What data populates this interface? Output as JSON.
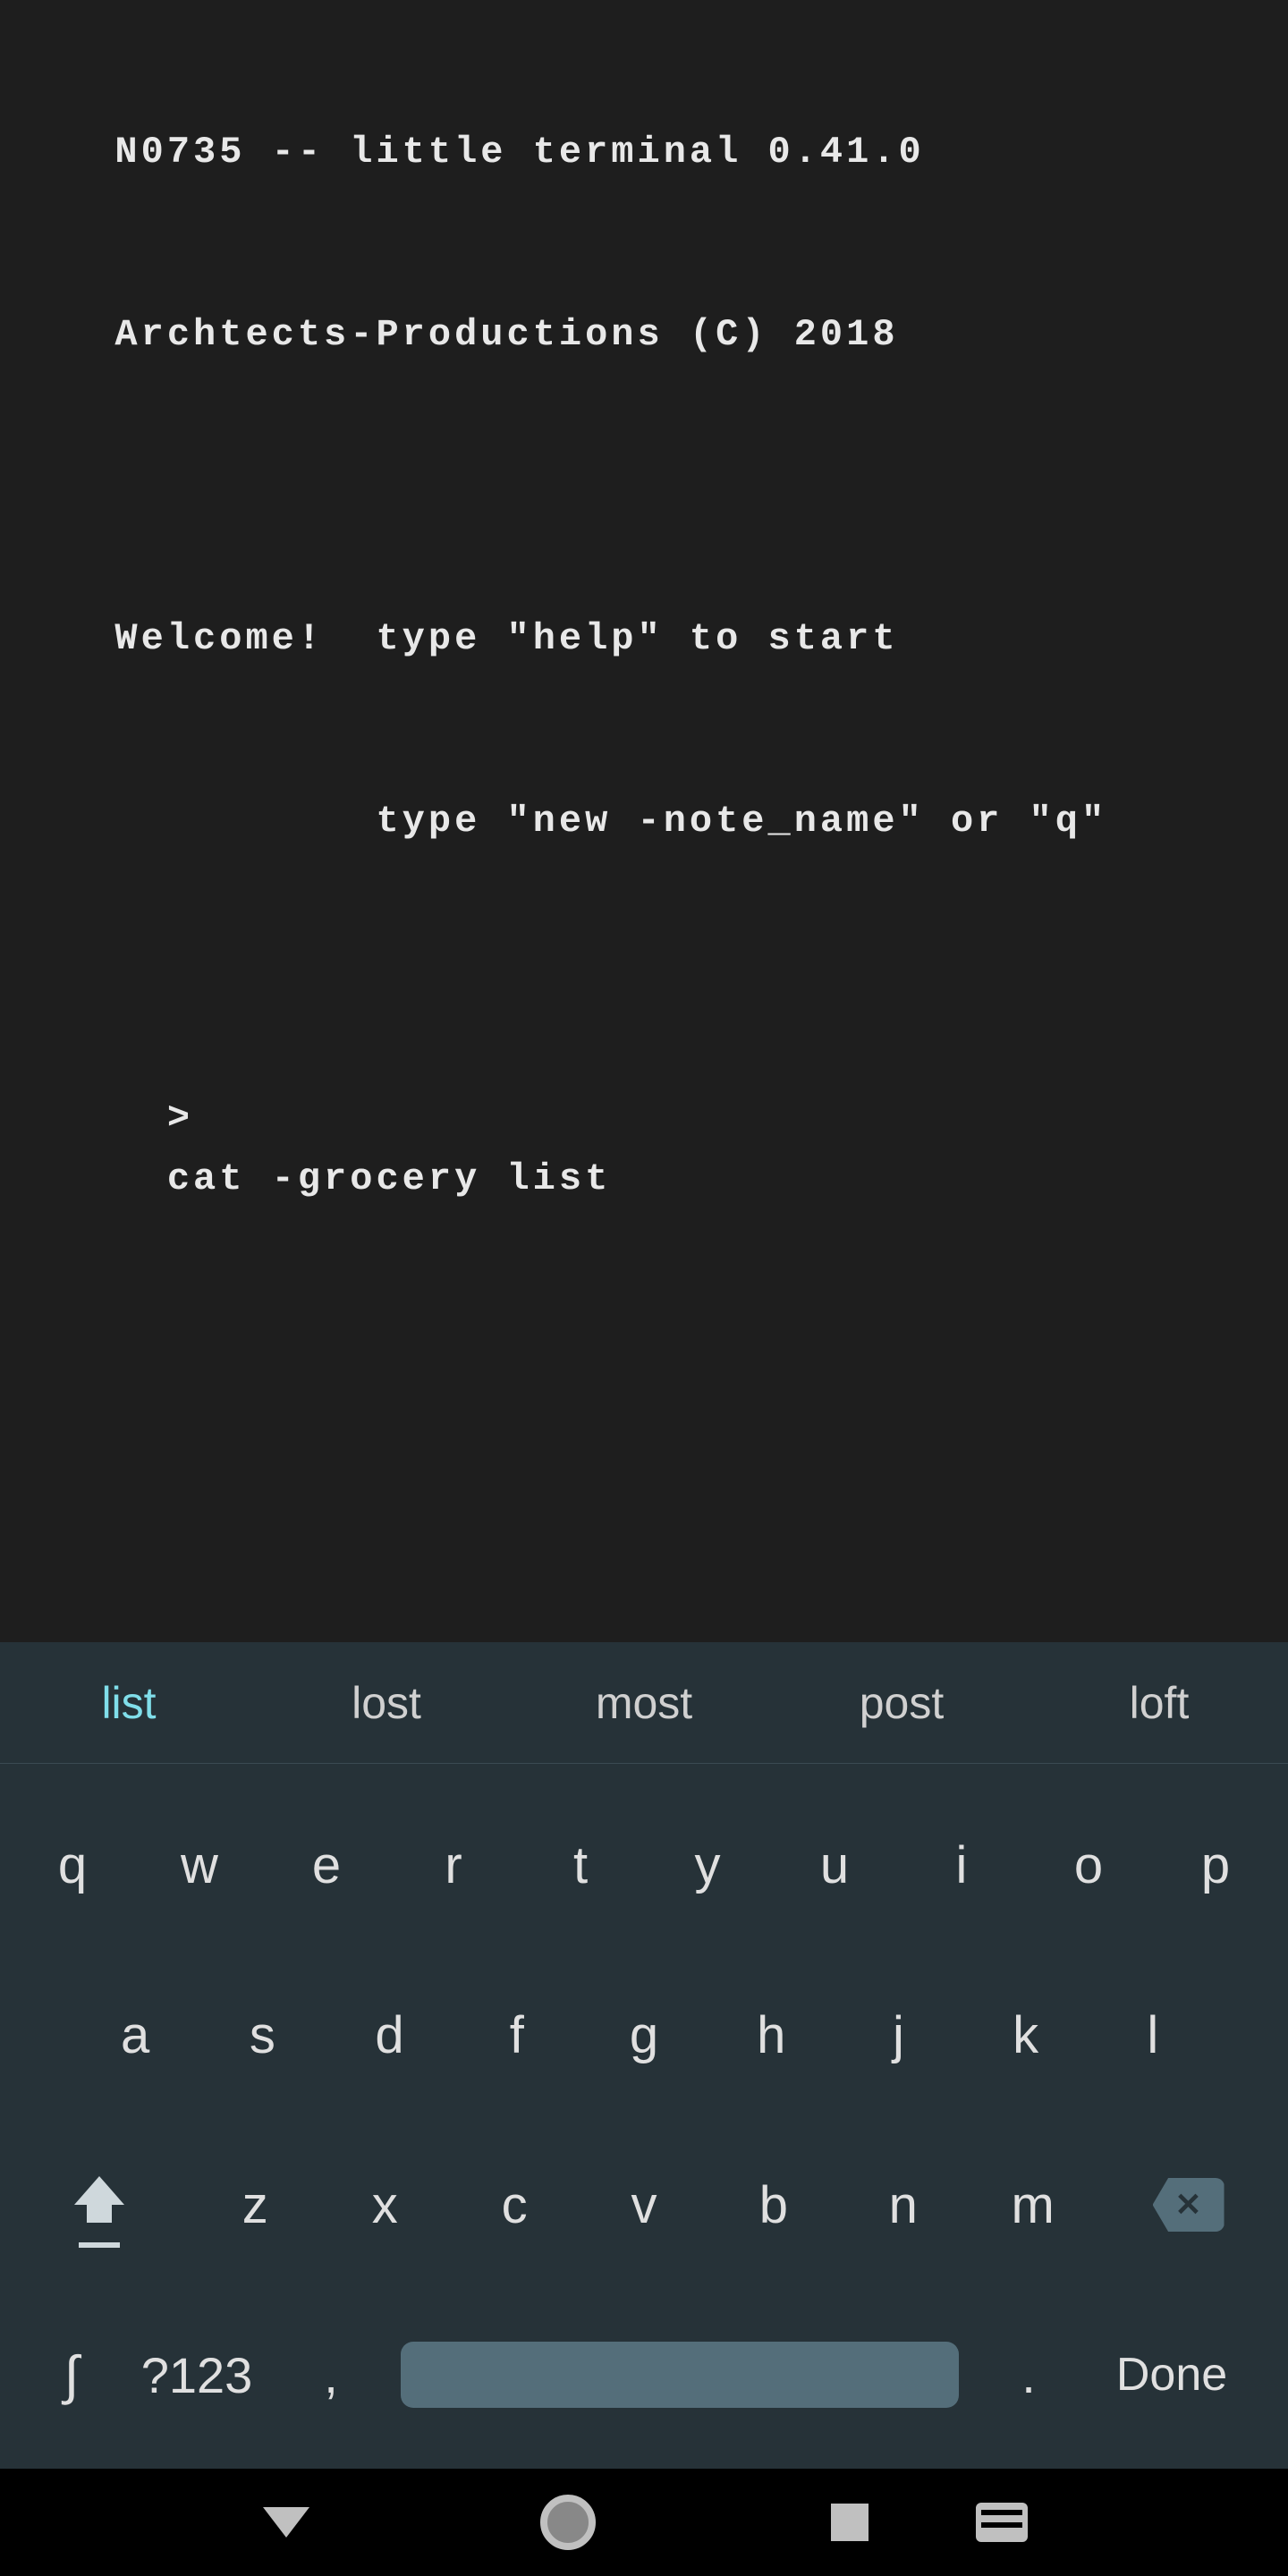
{
  "terminal": {
    "line1": "  N0735 -- little terminal 0.41.0",
    "line2": "  Archtects-Productions (C) 2018",
    "blank1": "",
    "line3": "  Welcome!  type \"help\" to start",
    "line4": "            type \"new -note_name\" or \"q\"",
    "prompt_symbol": ">",
    "prompt_command": "cat -grocery list"
  },
  "keyboard": {
    "suggestions": [
      "list",
      "lost",
      "most",
      "post",
      "loft"
    ],
    "suggestion_highlight_index": 0,
    "row1": [
      "q",
      "w",
      "e",
      "r",
      "t",
      "y",
      "u",
      "i",
      "o",
      "p"
    ],
    "row2": [
      "a",
      "s",
      "d",
      "f",
      "g",
      "h",
      "j",
      "k",
      "l"
    ],
    "row3": [
      "z",
      "x",
      "c",
      "v",
      "b",
      "n",
      "m"
    ],
    "mode_label": "?123",
    "comma_label": ",",
    "period_label": ".",
    "done_label": "Done"
  }
}
